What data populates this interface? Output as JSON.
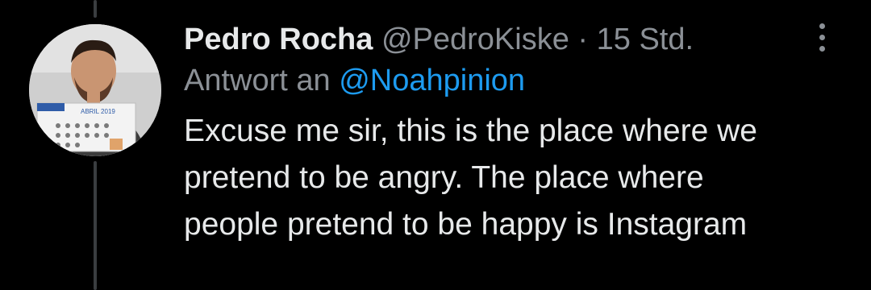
{
  "tweet": {
    "author_name": "Pedro Rocha",
    "author_handle": "@PedroKiske",
    "separator": "·",
    "time": "15 Std.",
    "reply_prefix": "Antwort an",
    "reply_handle": "@Noahpinion",
    "text_lines": [
      "Excuse me sir, this is the place where we",
      "pretend to be angry. The place where",
      "people pretend to be happy is Instagram"
    ],
    "avatar_calendar_text": "ABRIL 2019"
  },
  "colors": {
    "background": "#000000",
    "primary_text": "#e7e9ea",
    "secondary_text": "#8b9096",
    "link": "#1d9bf0",
    "thread_line": "#3a3d40"
  },
  "icons": {
    "more": "more-vertical-icon"
  }
}
